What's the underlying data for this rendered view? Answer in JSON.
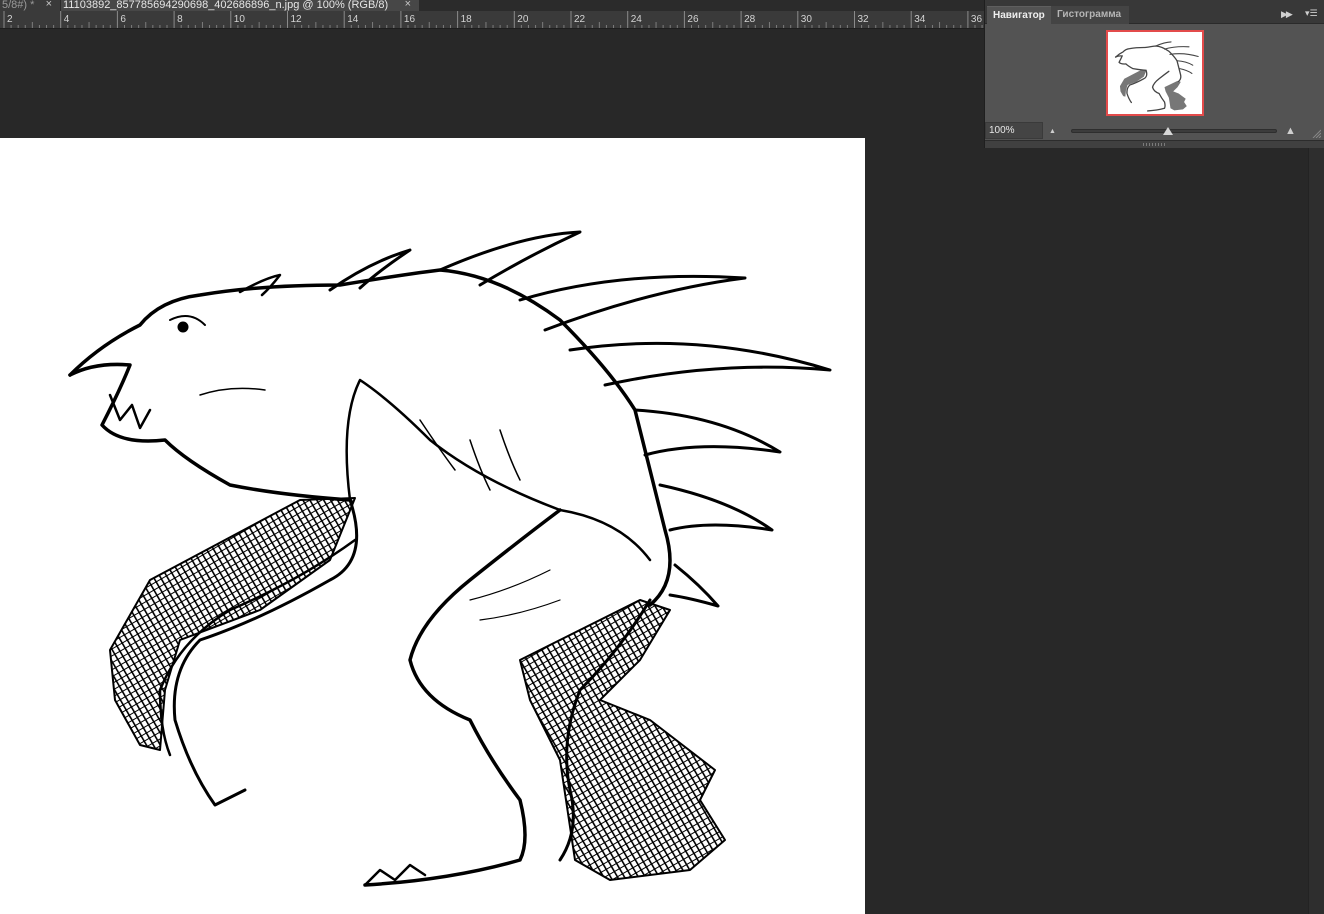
{
  "tabs": [
    {
      "label": "5/8#) *",
      "close": "×",
      "active": false
    },
    {
      "label": "11103892_857785694290698_402686896_n.jpg @ 100% (RGB/8)",
      "close": "×",
      "active": true
    }
  ],
  "ruler": {
    "labels": [
      "2",
      "4",
      "6",
      "8",
      "10",
      "12",
      "14",
      "16",
      "18",
      "20",
      "22",
      "24",
      "26",
      "28",
      "30",
      "32",
      "34",
      "36"
    ]
  },
  "navigator": {
    "tabs": [
      "Навигатор",
      "Гистограмма"
    ],
    "collapse_icon": "double-chevron-right-icon",
    "menu_icon": "panel-menu-icon",
    "zoom_value": "100%",
    "zoom_slider_fraction": 0.47
  },
  "colors": {
    "accent_view_box": "#e34b4b",
    "panel_bg": "#535353",
    "workspace_bg": "#282828"
  }
}
